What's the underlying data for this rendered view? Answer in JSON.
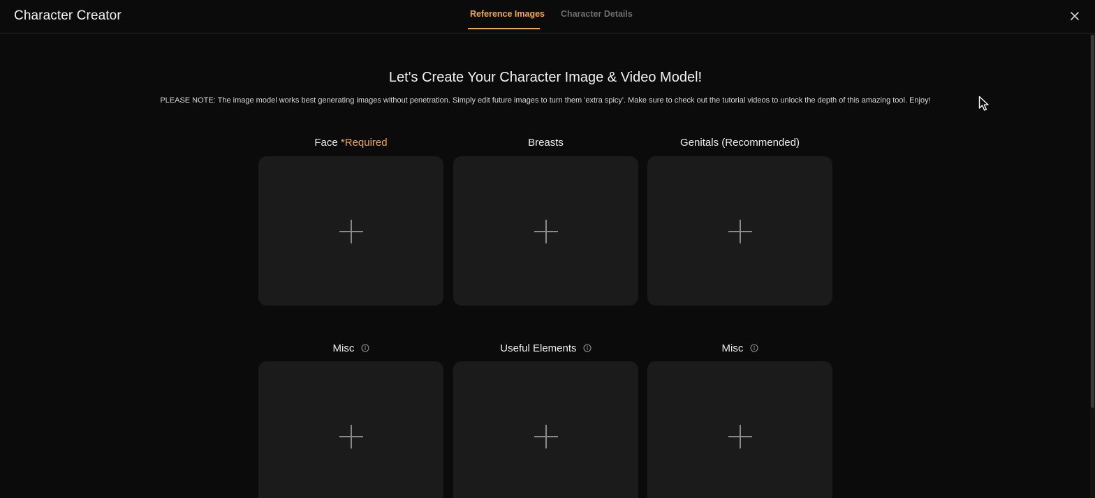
{
  "header": {
    "title": "Character Creator",
    "tabs": [
      {
        "label": "Reference Images",
        "active": true
      },
      {
        "label": "Character Details",
        "active": false
      }
    ],
    "close_icon": "close-icon"
  },
  "intro": {
    "heading": "Let's Create Your Character Image & Video Model!",
    "note": "PLEASE NOTE: The image model works best generating images without penetration. Simply edit future images to turn them 'extra spicy'. Make sure to check out the tutorial videos to unlock the depth of this amazing tool. Enjoy!"
  },
  "slots": [
    {
      "label": "Face",
      "required_text": "*Required",
      "icon": "plus-icon"
    },
    {
      "label": "Breasts",
      "icon": "plus-icon"
    },
    {
      "label": "Genitals (Recommended)",
      "icon": "plus-icon"
    },
    {
      "label": "Misc",
      "info_icon": "info-icon",
      "icon": "plus-icon"
    },
    {
      "label": "Useful Elements",
      "info_icon": "info-icon",
      "icon": "plus-icon"
    },
    {
      "label": "Misc",
      "info_icon": "info-icon",
      "icon": "plus-icon"
    }
  ],
  "colors": {
    "accent": "#f0a64a",
    "background": "#0b0b0b",
    "slot_bg": "#1b1b1b",
    "inactive_tab": "#6d6d6d"
  }
}
